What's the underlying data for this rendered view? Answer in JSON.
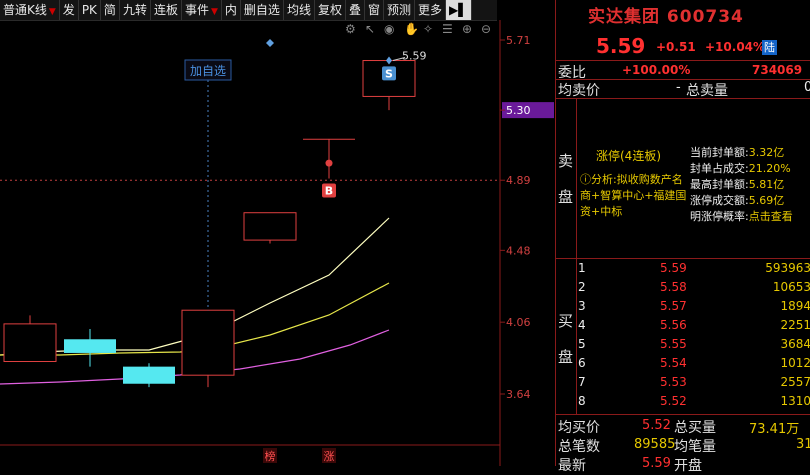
{
  "toolbar": {
    "items": [
      "普通K线",
      "发",
      "PK",
      "简",
      "九转",
      "连板",
      "事件",
      "内",
      "删自选",
      "均线",
      "复权",
      "叠",
      "窗",
      "预测",
      "更多"
    ],
    "dropdown_marker": "▼",
    "panel_icon": "▶▌"
  },
  "chart_icons": [
    "gear-icon",
    "cursor-icon",
    "eye-icon",
    "hand-icon",
    "wand-icon",
    "list-icon",
    "plus-icon",
    "minus-icon"
  ],
  "chart_data": {
    "type": "candlestick",
    "price_axis_labels": [
      "5.71",
      "5.30",
      "4.89",
      "4.48",
      "4.06",
      "3.64"
    ],
    "price_axis_values": [
      5.71,
      5.3,
      4.89,
      4.48,
      4.06,
      3.64
    ],
    "highlighted_price": "5.30",
    "reference_price": 4.89,
    "candles": [
      {
        "open": 4.05,
        "close": 3.83,
        "high": 4.1,
        "low": 3.83,
        "color": "red"
      },
      {
        "open": 3.96,
        "close": 3.88,
        "high": 4.02,
        "low": 3.8,
        "color": "cyan"
      },
      {
        "open": 3.8,
        "close": 3.7,
        "high": 3.82,
        "low": 3.68,
        "color": "cyan"
      },
      {
        "open": 3.75,
        "close": 4.13,
        "high": 4.13,
        "low": 3.68,
        "color": "red"
      },
      {
        "open": 4.54,
        "close": 4.7,
        "high": 4.7,
        "low": 4.52,
        "color": "red"
      },
      {
        "open": 5.13,
        "close": 5.13,
        "high": 5.13,
        "low": 4.9,
        "color": "red"
      },
      {
        "open": 5.38,
        "close": 5.59,
        "high": 5.59,
        "low": 5.3,
        "color": "red"
      }
    ],
    "markers": [
      {
        "label": "S",
        "candle": 6
      },
      {
        "label": "B",
        "candle": 5
      }
    ],
    "high_label": "5.59",
    "add_to_watchlist": "加自选",
    "bottom_tags": [
      "榜",
      "涨"
    ]
  },
  "stock": {
    "title": "实达集团 600734",
    "price": "5.59",
    "change": "+0.51",
    "change_pct": "+10.04%",
    "tag": "陆"
  },
  "summary": {
    "weibi_label": "委比",
    "weibi_pct": "+100.00%",
    "weibi_val": "734069",
    "junmaijia_label": "均卖价",
    "junmaijia_val": "-",
    "zongmailiang_label": "总卖量",
    "zongmailiang_val": "0"
  },
  "limit_up": {
    "side_label_top": "卖",
    "side_label_bottom": "盘",
    "title": "涨停(4连板)",
    "analysis": "ⓘ分析:拟收购数产名商+智算中心+福建国资+中标",
    "stats": [
      {
        "k": "当前封单额:",
        "v": "3.32亿"
      },
      {
        "k": "封单占成交:",
        "v": "21.20%"
      },
      {
        "k": "最高封单额:",
        "v": "5.81亿"
      },
      {
        "k": "涨停成交额:",
        "v": "5.69亿"
      },
      {
        "k": "明涨停概率:",
        "v": "点击查看"
      }
    ]
  },
  "bids": {
    "side_label_top": "买",
    "side_label_bottom": "盘",
    "rows": [
      {
        "n": "1",
        "p": "5.59",
        "v": "593963"
      },
      {
        "n": "2",
        "p": "5.58",
        "v": "10653"
      },
      {
        "n": "3",
        "p": "5.57",
        "v": "1894"
      },
      {
        "n": "4",
        "p": "5.56",
        "v": "2251"
      },
      {
        "n": "5",
        "p": "5.55",
        "v": "3684"
      },
      {
        "n": "6",
        "p": "5.54",
        "v": "1012"
      },
      {
        "n": "7",
        "p": "5.53",
        "v": "2557"
      },
      {
        "n": "8",
        "p": "5.52",
        "v": "1310"
      }
    ]
  },
  "footer": {
    "junmaijia_label": "均买价",
    "junmaijia_val": "5.52",
    "zongmailiang_label": "总买量",
    "zongmailiang_val": "73.41万",
    "zongbishu_label": "总笔数",
    "zongbishu_val": "89585",
    "junbiliang_label": "均笔量",
    "junbiliang_val": "31",
    "zuixin_label": "最新",
    "zuixin_val": "5.59",
    "kaipan_label": "开盘"
  }
}
